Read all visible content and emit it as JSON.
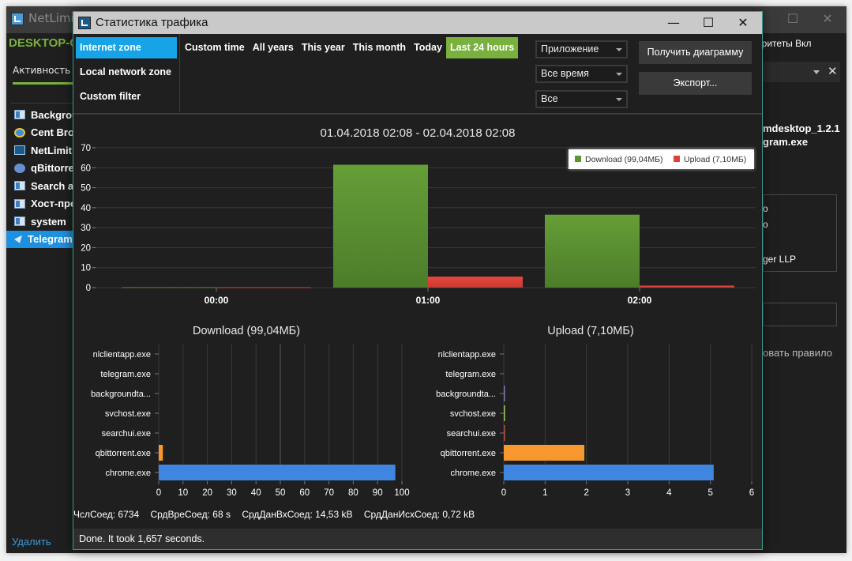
{
  "background_window": {
    "title": "NetLimit",
    "host": "DESKTOP-C",
    "tab": "Активность",
    "processes": [
      {
        "name": "Backgrou",
        "icon": "windows-app-icon",
        "selected": false
      },
      {
        "name": "Cent Bro",
        "icon": "cent-browser-icon",
        "selected": false
      },
      {
        "name": "NetLimit",
        "icon": "netlimiter-icon",
        "selected": false
      },
      {
        "name": "qBittorre",
        "icon": "qbittorrent-icon",
        "selected": false
      },
      {
        "name": "Search a",
        "icon": "windows-app-icon",
        "selected": false
      },
      {
        "name": "Хост-пре",
        "icon": "windows-app-icon",
        "selected": false
      },
      {
        "name": "system",
        "icon": "windows-app-icon",
        "selected": false
      },
      {
        "name": "Telegram",
        "icon": "telegram-icon",
        "selected": true
      }
    ],
    "delete_link": "Удалить",
    "right_panel": {
      "priorities": "оритеты Вкл",
      "file_line1": "mdesktop_1.2.1",
      "file_line2": "gram.exe",
      "info_line1": "o",
      "info_line2": "o",
      "info_line3": "ger LLP",
      "rule_link": "овать правило"
    },
    "controls": {
      "minimize": "—",
      "maximize": "☐",
      "close": "✕"
    }
  },
  "dialog": {
    "title": "Статистика трафика",
    "controls": {
      "minimize": "—",
      "maximize": "☐",
      "close": "✕"
    },
    "zones": [
      {
        "label": "Internet zone",
        "selected": true
      },
      {
        "label": "Local network zone",
        "selected": false
      },
      {
        "label": "Custom filter",
        "selected": false
      }
    ],
    "periods": [
      {
        "label": "Custom time",
        "selected": false
      },
      {
        "label": "All years",
        "selected": false
      },
      {
        "label": "This year",
        "selected": false
      },
      {
        "label": "This month",
        "selected": false
      },
      {
        "label": "Today",
        "selected": false
      },
      {
        "label": "Last 24 hours",
        "selected": true
      }
    ],
    "selects": {
      "group_by": "Приложение",
      "time": "Все время",
      "filter": "Все"
    },
    "buttons": {
      "get_chart": "Получить диаграмму",
      "export": "Экспорт..."
    },
    "stats": {
      "connections": "ЧслСоед: 6734",
      "avg_time": "СрдВреСоед: 68 s",
      "avg_in": "СрдДанВхСоед: 14,53 kB",
      "avg_out": "СрдДанИсхСоед: 0,72 kB"
    },
    "status": "Done. It took 1,657 seconds."
  },
  "colors": {
    "download": "#5b9632",
    "upload": "#e0403a",
    "accent_blue": "#16a3e8",
    "accent_green": "#7ab13e",
    "chrome": "#3f86e0",
    "qbittorrent": "#f7982f",
    "searchui": "#b84a4a",
    "svchost": "#9cc05a",
    "backgroundta": "#7a7ab0"
  },
  "chart_data": [
    {
      "type": "bar",
      "title": "01.04.2018 02:08 - 02.04.2018 02:08",
      "categories": [
        "00:00",
        "01:00",
        "02:00"
      ],
      "series": [
        {
          "name": "Download (99,04МБ)",
          "values": [
            0.2,
            61.5,
            36.5
          ]
        },
        {
          "name": "Upload (7,10МБ)",
          "values": [
            0.2,
            5.5,
            1.0
          ]
        }
      ],
      "ylim": [
        0,
        70
      ],
      "yticks": [
        0,
        10,
        20,
        30,
        40,
        50,
        60,
        70
      ],
      "legend": "top-right",
      "grid": true,
      "xlabel": "",
      "ylabel": ""
    },
    {
      "type": "bar",
      "orientation": "horizontal",
      "title": "Download (99,04МБ)",
      "categories": [
        "nlclientapp.exe",
        "telegram.exe",
        "backgroundta...",
        "svchost.exe",
        "searchui.exe",
        "qbittorrent.exe",
        "chrome.exe"
      ],
      "values": [
        0,
        0,
        0,
        0,
        0,
        1.7,
        97.3
      ],
      "xlim": [
        0,
        100
      ],
      "xticks": [
        0,
        10,
        20,
        30,
        40,
        50,
        60,
        70,
        80,
        90,
        100
      ],
      "grid": true
    },
    {
      "type": "bar",
      "orientation": "horizontal",
      "title": "Upload (7,10МБ)",
      "categories": [
        "nlclientapp.exe",
        "telegram.exe",
        "backgroundta...",
        "svchost.exe",
        "searchui.exe",
        "qbittorrent.exe",
        "chrome.exe"
      ],
      "values": [
        0,
        0,
        0.01,
        0.03,
        0.03,
        1.95,
        5.08
      ],
      "xlim": [
        0,
        6
      ],
      "xticks": [
        0,
        1,
        2,
        3,
        4,
        5,
        6
      ],
      "grid": true
    }
  ]
}
